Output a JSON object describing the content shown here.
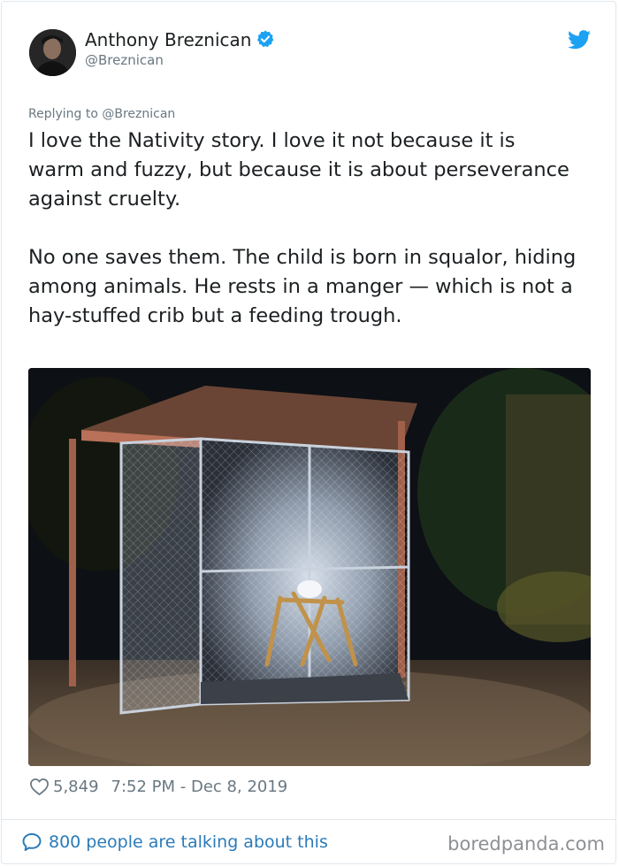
{
  "author": {
    "display_name": "Anthony Breznican",
    "handle": "@Breznican",
    "verified": true
  },
  "reply_to": "Replying to @Breznican",
  "tweet": {
    "paragraphs": [
      "I love the Nativity story. I love it not because it is warm and fuzzy, but because it is about perseverance against cruelty.",
      "No one saves them. The child is born in squalor, hiding among animals. He rests in a manger — which is not a hay-stuffed crib but a feeding trough."
    ]
  },
  "meta": {
    "likes": "5,849",
    "timestamp": "7:52 PM - Dec 8, 2019"
  },
  "footer": {
    "conversation_text": "800 people are talking about this",
    "watermark": "boredpanda.com"
  },
  "icons": {
    "verified": "verified-badge-icon",
    "bird": "twitter-bird-icon",
    "heart": "heart-icon",
    "bubble": "speech-bubble-icon"
  },
  "colors": {
    "twitter_blue": "#1da1f2",
    "link_blue": "#2b7bb9",
    "muted_gray": "#697882"
  }
}
